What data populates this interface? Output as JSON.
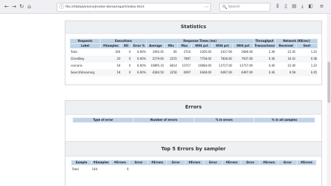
{
  "browser": {
    "url": "file:///data/jenkins/jmeter-demo/report/index.html",
    "search_placeholder": "Search"
  },
  "statistics": {
    "title": "Statistics",
    "group_headers": [
      "Requests",
      "Executions",
      "Response Times (ms)",
      "Throughput",
      "Network (KB/sec)"
    ],
    "columns": [
      "Label",
      "#Samples",
      "KO",
      "Error %",
      "Average",
      "Min",
      "Max",
      "90th pct",
      "95th pct",
      "99th pct",
      "Transactions/s",
      "Received",
      "Sent"
    ],
    "rows": [
      [
        "Total",
        "164",
        "0",
        "0.00%",
        "1093.45",
        "85",
        "2716",
        "2305.00",
        "2417.00",
        "2680.00",
        "2.39",
        "22.45",
        "1.23"
      ],
      [
        "ClientBeg",
        "20",
        "0",
        "0.00%",
        "2279.60",
        "2255",
        "7987",
        "7758.00",
        "7836.60",
        "7937.00",
        "0.36",
        "16.41",
        "0.38"
      ],
      [
        "scenario",
        "18",
        "0",
        "0.00%",
        "10895.33",
        "8414",
        "13717",
        "10684.00",
        "13717.00",
        "13717.00",
        "0.40",
        "22.40",
        "1.23"
      ],
      [
        "SearchStreaming",
        "18",
        "0",
        "0.00%",
        "4284.50",
        "2256",
        "6097",
        "6448.00",
        "6497.00",
        "6497.00",
        "0.36",
        "9.58",
        "0.45"
      ]
    ]
  },
  "errors": {
    "title": "Errors",
    "columns": [
      "Type of error",
      "Number of errors",
      "% in errors",
      "% in all samples"
    ]
  },
  "top5": {
    "title": "Top 5 Errors by sampler",
    "columns": [
      "Sample",
      "#Samples",
      "#Errors",
      "Error",
      "#Errors",
      "Error",
      "#Errors",
      "Error",
      "#Errors",
      "Error",
      "#Errors",
      "Error",
      "#Errors"
    ],
    "rows": [
      [
        "Total",
        "164",
        "0",
        "",
        "",
        "",
        "",
        "",
        "",
        "",
        "",
        "",
        ""
      ]
    ]
  },
  "icons": {
    "back": "back-arrow-icon",
    "forward": "forward-arrow-icon",
    "reload": "reload-icon",
    "home": "home-icon",
    "menu": "hamburger-menu-icon"
  }
}
